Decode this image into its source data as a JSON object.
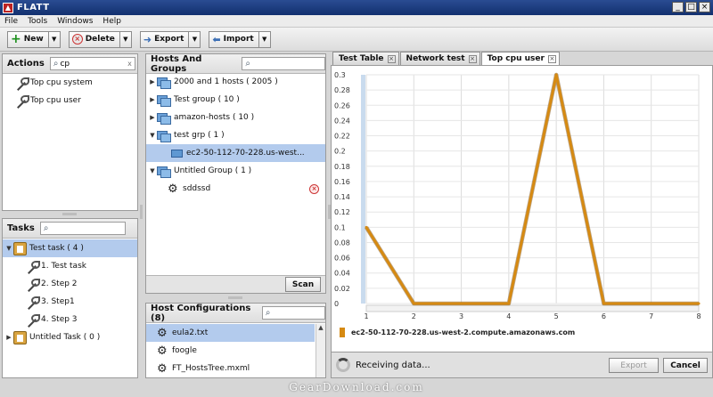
{
  "window": {
    "title": "FLATT",
    "min": "_",
    "max": "□",
    "close": "×"
  },
  "menu": [
    "File",
    "Tools",
    "Windows",
    "Help"
  ],
  "toolbar": {
    "new": "New",
    "delete": "Delete",
    "export": "Export",
    "import": "Import"
  },
  "actions": {
    "title": "Actions",
    "search_value": "cp",
    "clear": "x",
    "items": [
      "Top cpu system",
      "Top cpu user"
    ]
  },
  "tasks": {
    "title": "Tasks",
    "items": [
      {
        "label": "Test task ( 4 )",
        "level": 0,
        "expanded": true,
        "selected": true
      },
      {
        "label": "1. Test task",
        "level": 1
      },
      {
        "label": "2. Step 2",
        "level": 1
      },
      {
        "label": "3. Step1",
        "level": 1
      },
      {
        "label": "4. Step 3",
        "level": 1
      },
      {
        "label": "Untitled Task ( 0 )",
        "level": 0,
        "expanded": false
      }
    ]
  },
  "hosts": {
    "title": "Hosts And Groups",
    "items": [
      {
        "label": "2000 and 1 hosts ( 2005 )",
        "type": "group",
        "expanded": false
      },
      {
        "label": "Test group ( 10 )",
        "type": "group",
        "expanded": false
      },
      {
        "label": "amazon-hosts ( 10 )",
        "type": "group",
        "expanded": false
      },
      {
        "label": "test grp ( 1 )",
        "type": "group",
        "expanded": true
      },
      {
        "label": "ec2-50-112-70-228.us-west...",
        "type": "host",
        "selected": true
      },
      {
        "label": "Untitled Group ( 1 )",
        "type": "group",
        "expanded": true
      },
      {
        "label": "sddssd",
        "type": "gear"
      }
    ],
    "scan_label": "Scan"
  },
  "host_config": {
    "title": "Host Configurations (8)",
    "items": [
      {
        "label": "eula2.txt",
        "selected": true
      },
      {
        "label": "foogle"
      },
      {
        "label": "FT_HostsTree.mxml"
      }
    ]
  },
  "tabs": [
    {
      "label": "Test Table",
      "active": false
    },
    {
      "label": "Network test",
      "active": false
    },
    {
      "label": "Top cpu user",
      "active": true
    }
  ],
  "tab_close": "×",
  "chart_data": {
    "type": "line",
    "x": [
      1,
      2,
      3,
      4,
      5,
      6,
      7,
      8
    ],
    "series": [
      {
        "name": "ec2-50-112-70-228.us-west-2.compute.amazonaws.com",
        "values": [
          0.1,
          0,
          0,
          0,
          0.3,
          0,
          0,
          0
        ],
        "color": "#d68a12"
      }
    ],
    "xlim": [
      1,
      8
    ],
    "ylim": [
      0,
      0.3
    ],
    "yticks": [
      0,
      0.02,
      0.04,
      0.06,
      0.08,
      0.1,
      0.12,
      0.14,
      0.16,
      0.18,
      0.2,
      0.22,
      0.24,
      0.26,
      0.28,
      0.3
    ],
    "xticks": [
      1,
      2,
      3,
      4,
      5,
      6,
      7,
      8
    ],
    "ytick_labels": [
      "0",
      "0.02",
      "0.04",
      "0.06",
      "0.08",
      "0.1",
      "0.12",
      "0.14",
      "0.16",
      "0.18",
      "0.2",
      "0.22",
      "0.24",
      "0.26",
      "0.28",
      "0.3"
    ],
    "grid": true,
    "legend": "bottom-left"
  },
  "status": {
    "text": "Receiving data...",
    "export": "Export",
    "cancel": "Cancel"
  },
  "watermark": "GearDownload.com"
}
